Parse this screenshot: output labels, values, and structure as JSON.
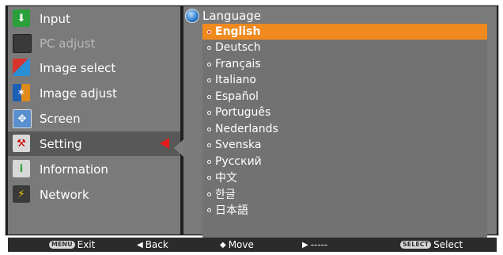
{
  "sidebar": {
    "items": [
      {
        "label": "Input",
        "icon": "input-arrow-icon",
        "state": "normal"
      },
      {
        "label": "PC adjust",
        "icon": "monitor-icon",
        "state": "disabled"
      },
      {
        "label": "Image select",
        "icon": "image-select-icon",
        "state": "normal"
      },
      {
        "label": "Image adjust",
        "icon": "image-adjust-icon",
        "state": "normal"
      },
      {
        "label": "Screen",
        "icon": "screen-icon",
        "state": "normal"
      },
      {
        "label": "Setting",
        "icon": "setting-tools-icon",
        "state": "selected"
      },
      {
        "label": "Information",
        "icon": "information-icon",
        "state": "normal"
      },
      {
        "label": "Network",
        "icon": "network-icon",
        "state": "normal"
      }
    ]
  },
  "panel": {
    "title": "Language",
    "languages": [
      {
        "label": "English",
        "selected": true
      },
      {
        "label": "Deutsch",
        "selected": false
      },
      {
        "label": "Français",
        "selected": false
      },
      {
        "label": "Italiano",
        "selected": false
      },
      {
        "label": "Español",
        "selected": false
      },
      {
        "label": "Português",
        "selected": false
      },
      {
        "label": "Nederlands",
        "selected": false
      },
      {
        "label": "Svenska",
        "selected": false
      },
      {
        "label": "Русский",
        "selected": false
      },
      {
        "label": "中文",
        "selected": false
      },
      {
        "label": "한글",
        "selected": false
      },
      {
        "label": "日本語",
        "selected": false
      }
    ]
  },
  "statusbar": {
    "exit": {
      "chip": "MENU",
      "label": "Exit"
    },
    "back": {
      "glyph": "◀",
      "label": "Back"
    },
    "move": {
      "glyph": "◆",
      "label": "Move"
    },
    "next": {
      "glyph": "▶",
      "label": "-----"
    },
    "select": {
      "chip": "SELECT",
      "label": "Select"
    }
  },
  "colors": {
    "highlight": "#f08a1f",
    "selection_arrow": "#e21a1a",
    "panel_bg": "#7a7a7a"
  }
}
